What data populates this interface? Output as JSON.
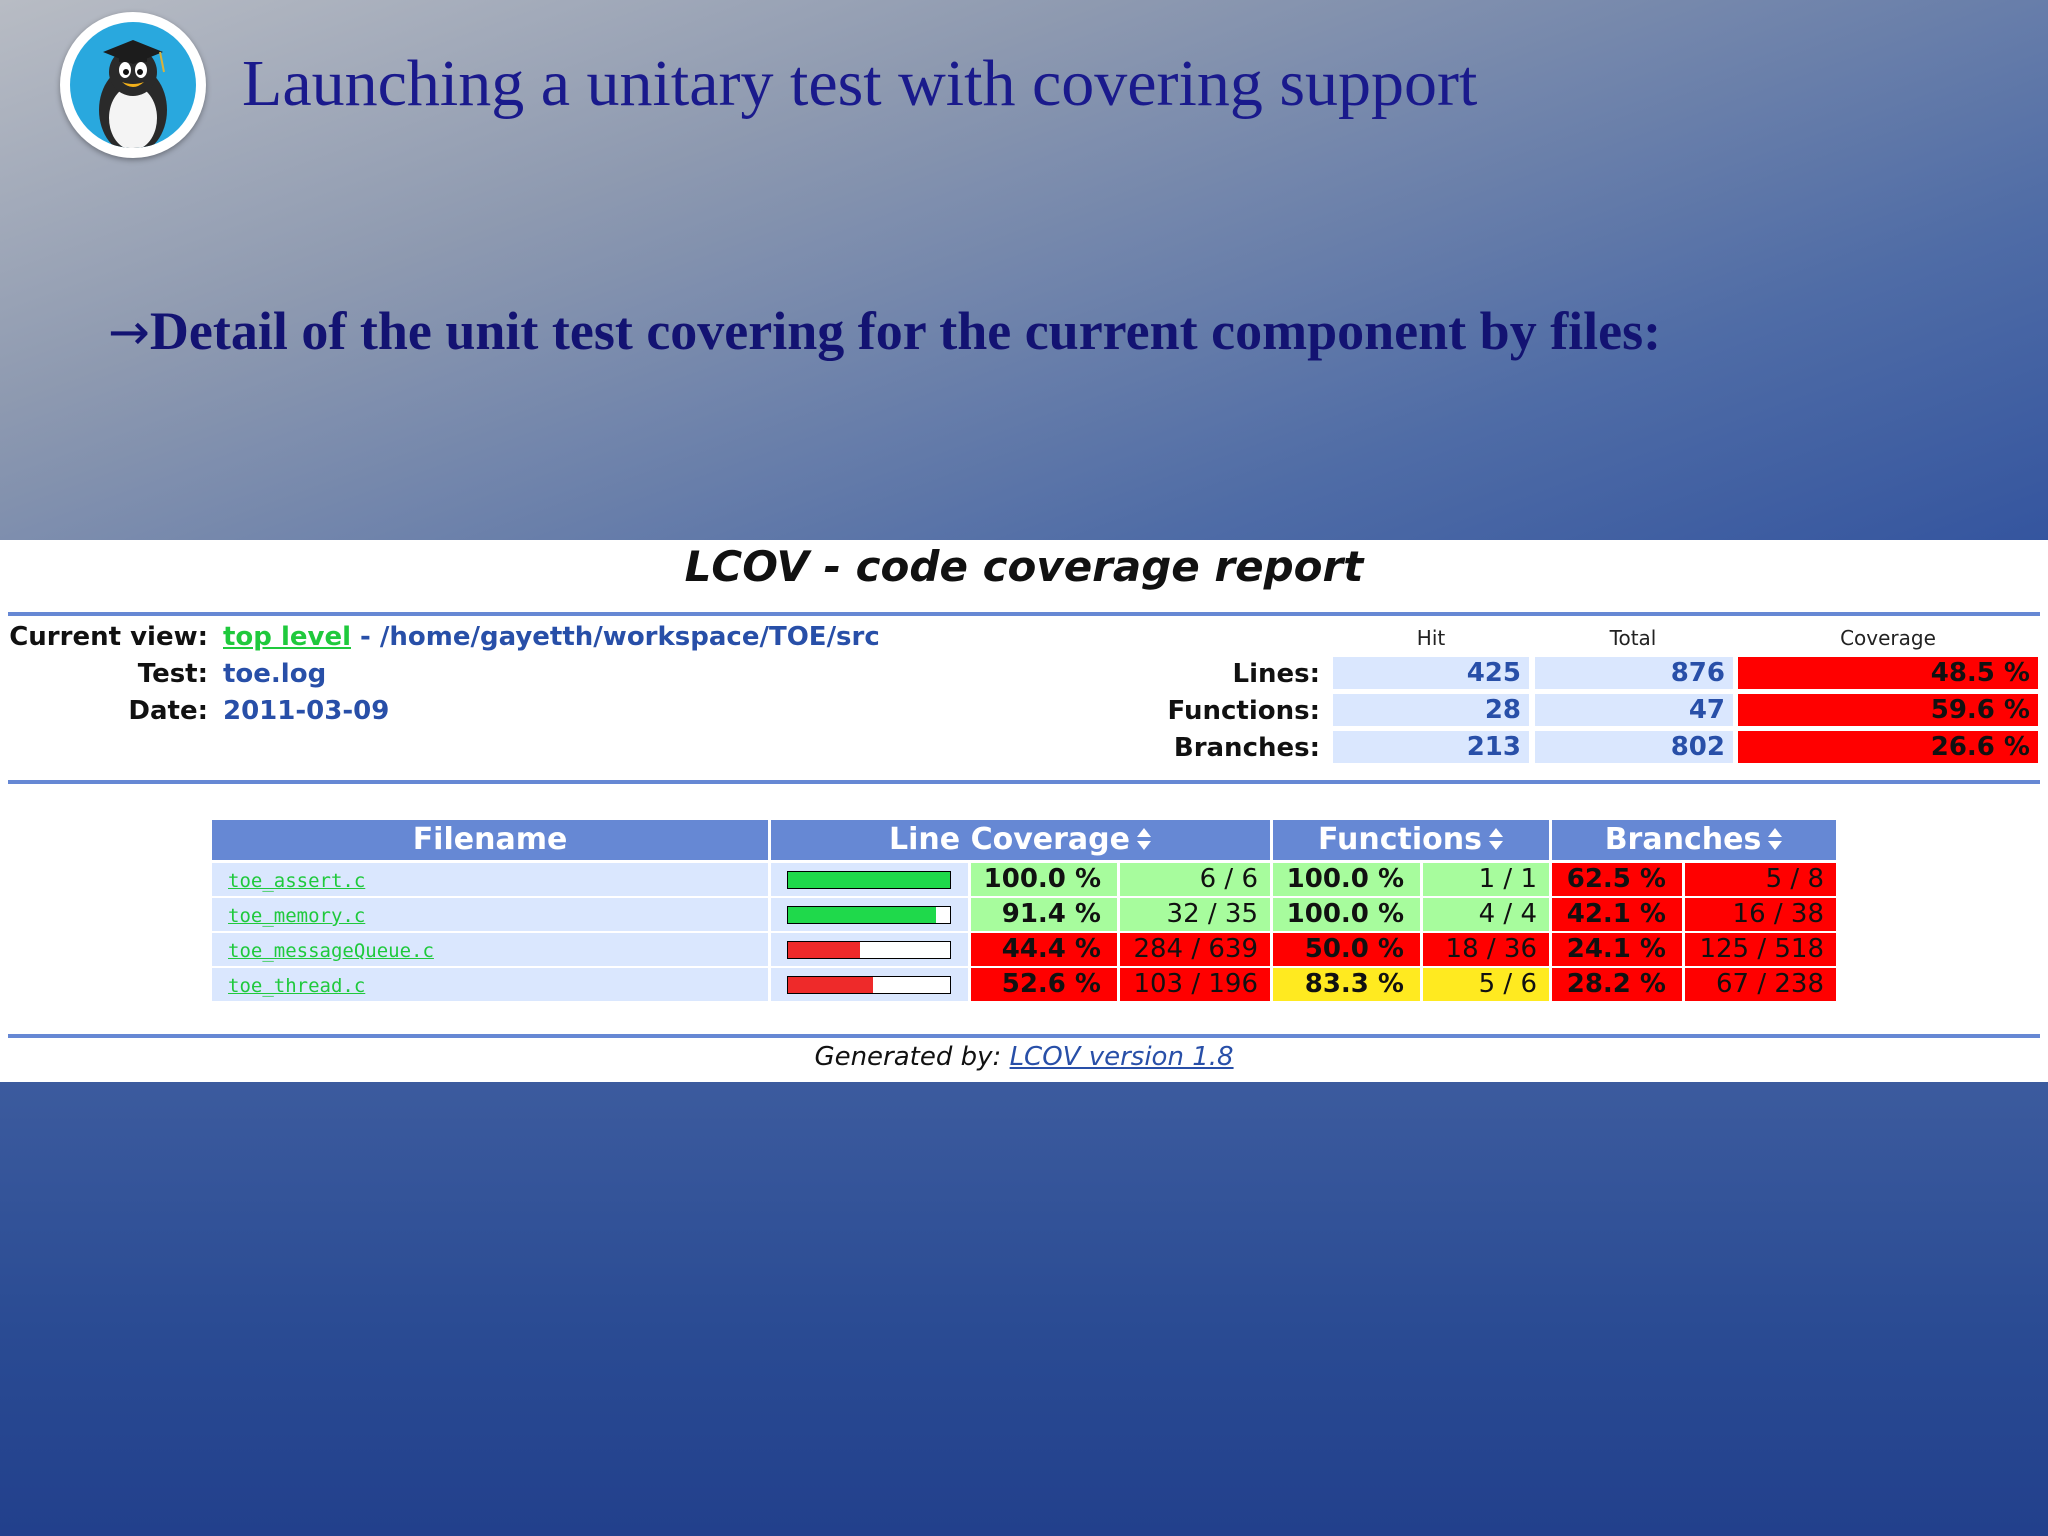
{
  "slide": {
    "title": "Launching a unitary test with covering support",
    "bullet_arrow": "→",
    "bullet": "Detail of the unit test covering for the current component by files:",
    "logo_icon": "penguin-graduate-icon"
  },
  "report": {
    "title": "LCOV - code coverage report",
    "info": {
      "current_view_label": "Current view:",
      "top_level_link": "top level",
      "separator": " - ",
      "path": "/home/gayetth/workspace/TOE/src",
      "test_label": "Test:",
      "test_value": "toe.log",
      "date_label": "Date:",
      "date_value": "2011-03-09"
    },
    "summary": {
      "headers": [
        "Hit",
        "Total",
        "Coverage"
      ],
      "rows": [
        {
          "label": "Lines:",
          "hit": "425",
          "total": "876",
          "coverage": "48.5 %"
        },
        {
          "label": "Functions:",
          "hit": "28",
          "total": "47",
          "coverage": "59.6 %"
        },
        {
          "label": "Branches:",
          "hit": "213",
          "total": "802",
          "coverage": "26.6 %"
        }
      ]
    },
    "table": {
      "headers": {
        "filename": "Filename",
        "line_coverage": "Line Coverage",
        "functions": "Functions",
        "branches": "Branches"
      },
      "rows": [
        {
          "file": "toe_assert.c",
          "line_fraction": 1.0,
          "line_pct": "100.0 %",
          "line_cnt": "6 / 6",
          "line_level": "hi",
          "func_pct": "100.0 %",
          "func_cnt": "1 / 1",
          "func_level": "hi",
          "br_pct": "62.5 %",
          "br_cnt": "5 / 8",
          "br_level": "lo"
        },
        {
          "file": "toe_memory.c",
          "line_fraction": 0.914,
          "line_pct": "91.4 %",
          "line_cnt": "32 / 35",
          "line_level": "hi",
          "func_pct": "100.0 %",
          "func_cnt": "4 / 4",
          "func_level": "hi",
          "br_pct": "42.1 %",
          "br_cnt": "16 / 38",
          "br_level": "lo"
        },
        {
          "file": "toe_messageQueue.c",
          "line_fraction": 0.444,
          "line_pct": "44.4 %",
          "line_cnt": "284 / 639",
          "line_level": "lo",
          "func_pct": "50.0 %",
          "func_cnt": "18 / 36",
          "func_level": "lo",
          "br_pct": "24.1 %",
          "br_cnt": "125 / 518",
          "br_level": "lo"
        },
        {
          "file": "toe_thread.c",
          "line_fraction": 0.526,
          "line_pct": "52.6 %",
          "line_cnt": "103 / 196",
          "line_level": "lo",
          "func_pct": "83.3 %",
          "func_cnt": "5 / 6",
          "func_level": "med",
          "br_pct": "28.2 %",
          "br_cnt": "67 / 238",
          "br_level": "lo"
        }
      ]
    },
    "footer": {
      "label": "Generated by: ",
      "link": "LCOV version 1.8"
    },
    "colors": {
      "bar_high": "#1fd94b",
      "bar_low": "#ee2a2a"
    }
  }
}
